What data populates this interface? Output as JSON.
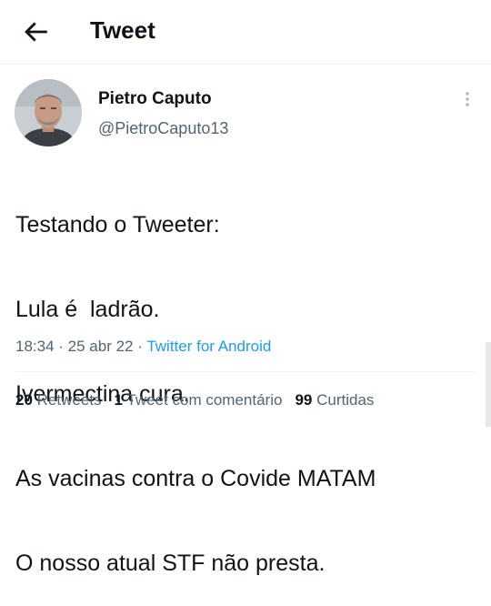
{
  "header": {
    "title": "Tweet",
    "back_icon": "arrow-left-icon"
  },
  "author": {
    "name": "Pietro Caputo",
    "handle": "@PietroCaputo13"
  },
  "tweet": {
    "lines": [
      "Testando o Tweeter:",
      "Lula é  ladrão.",
      "Ivermectina cura.",
      "As vacinas contra o Covide MATAM",
      "O nosso atual STF não presta."
    ]
  },
  "meta": {
    "time": "18:34",
    "sep1": " · ",
    "date": "25 abr 22",
    "sep2": " · ",
    "source": "Twitter for Android"
  },
  "stats": {
    "retweets_count": "20",
    "retweets_label": "Retweets",
    "quotes_count": "1",
    "quotes_label": "Tweet com comentário",
    "likes_count": "99",
    "likes_label": "Curtidas"
  },
  "colors": {
    "accent": "#1d9bf0",
    "text": "#0f1419",
    "secondary": "#536471"
  }
}
